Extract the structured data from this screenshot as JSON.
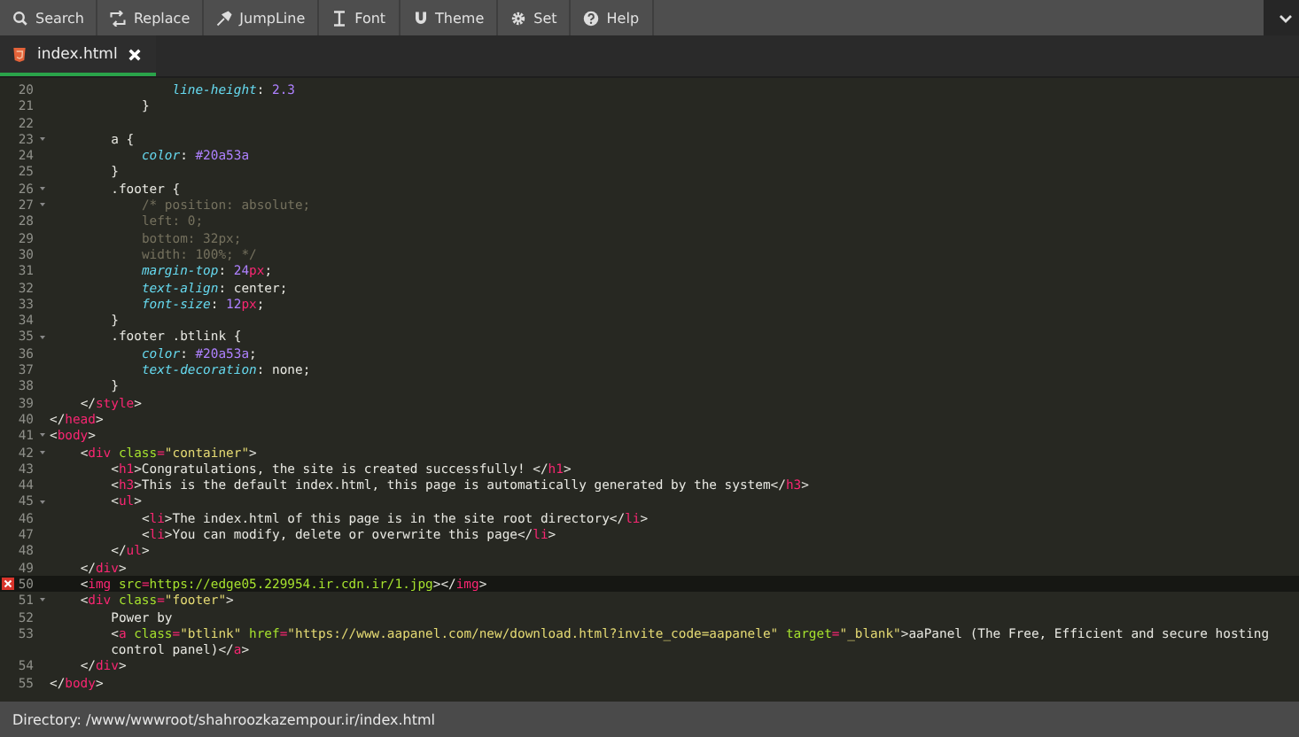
{
  "toolbar": [
    {
      "label": "Search"
    },
    {
      "label": "Replace"
    },
    {
      "label": "JumpLine"
    },
    {
      "label": "Font"
    },
    {
      "label": "Theme"
    },
    {
      "label": "Set"
    },
    {
      "label": "Help"
    }
  ],
  "tabs": [
    {
      "label": "index.html",
      "selected": true
    }
  ],
  "editor": {
    "lines": [
      {
        "number": "20",
        "foldable": false,
        "error": false,
        "current": false,
        "tokens": [
          {
            "kind": "prop",
            "text": "                line-height"
          },
          {
            "kind": "plain",
            "text": ": "
          },
          {
            "kind": "num",
            "text": "2.3"
          }
        ]
      },
      {
        "number": "21",
        "foldable": false,
        "error": false,
        "current": false,
        "tokens": [
          {
            "kind": "plain",
            "text": "            }"
          }
        ]
      },
      {
        "number": "22",
        "foldable": false,
        "error": false,
        "current": false
      },
      {
        "number": "23",
        "foldable": true,
        "error": false,
        "current": false,
        "tokens": [
          {
            "kind": "plain",
            "text": "        a {"
          }
        ]
      },
      {
        "number": "24",
        "foldable": false,
        "error": false,
        "current": false,
        "tokens": [
          {
            "kind": "prop",
            "text": "            color"
          },
          {
            "kind": "plain",
            "text": ": "
          },
          {
            "kind": "num",
            "text": "#20a53a"
          }
        ]
      },
      {
        "number": "25",
        "foldable": false,
        "error": false,
        "current": false,
        "tokens": [
          {
            "kind": "plain",
            "text": "        }"
          }
        ]
      },
      {
        "number": "26",
        "foldable": true,
        "error": false,
        "current": false,
        "tokens": [
          {
            "kind": "plain",
            "text": "        .footer {"
          }
        ]
      },
      {
        "number": "27",
        "foldable": true,
        "error": false,
        "current": false,
        "tokens": [
          {
            "kind": "comment",
            "text": "            /* position: absolute;"
          }
        ]
      },
      {
        "number": "28",
        "foldable": false,
        "error": false,
        "current": false,
        "tokens": [
          {
            "kind": "comment",
            "text": "            left: 0;"
          }
        ]
      },
      {
        "number": "29",
        "foldable": false,
        "error": false,
        "current": false,
        "tokens": [
          {
            "kind": "comment",
            "text": "            bottom: 32px;"
          }
        ]
      },
      {
        "number": "30",
        "foldable": false,
        "error": false,
        "current": false,
        "tokens": [
          {
            "kind": "comment",
            "text": "            width: 100%; */"
          }
        ]
      },
      {
        "number": "31",
        "foldable": false,
        "error": false,
        "current": false,
        "tokens": [
          {
            "kind": "prop",
            "text": "            margin-top"
          },
          {
            "kind": "plain",
            "text": ": "
          },
          {
            "kind": "num",
            "text": "24"
          },
          {
            "kind": "unit",
            "text": "px"
          },
          {
            "kind": "plain",
            "text": ";"
          }
        ]
      },
      {
        "number": "32",
        "foldable": false,
        "error": false,
        "current": false,
        "tokens": [
          {
            "kind": "prop",
            "text": "            text-align"
          },
          {
            "kind": "plain",
            "text": ": center;"
          }
        ]
      },
      {
        "number": "33",
        "foldable": false,
        "error": false,
        "current": false,
        "tokens": [
          {
            "kind": "prop",
            "text": "            font-size"
          },
          {
            "kind": "plain",
            "text": ": "
          },
          {
            "kind": "num",
            "text": "12"
          },
          {
            "kind": "unit",
            "text": "px"
          },
          {
            "kind": "plain",
            "text": ";"
          }
        ]
      },
      {
        "number": "34",
        "foldable": false,
        "error": false,
        "current": false,
        "tokens": [
          {
            "kind": "plain",
            "text": "        }"
          }
        ]
      },
      {
        "number": "35",
        "foldable": true,
        "error": false,
        "current": false,
        "tokens": [
          {
            "kind": "plain",
            "text": "        .footer .btlink {"
          }
        ]
      },
      {
        "number": "36",
        "foldable": false,
        "error": false,
        "current": false,
        "tokens": [
          {
            "kind": "prop",
            "text": "            color"
          },
          {
            "kind": "plain",
            "text": ": "
          },
          {
            "kind": "num",
            "text": "#20a53a"
          },
          {
            "kind": "plain",
            "text": ";"
          }
        ]
      },
      {
        "number": "37",
        "foldable": false,
        "error": false,
        "current": false,
        "tokens": [
          {
            "kind": "prop",
            "text": "            text-decoration"
          },
          {
            "kind": "plain",
            "text": ": none;"
          }
        ]
      },
      {
        "number": "38",
        "foldable": false,
        "error": false,
        "current": false,
        "tokens": [
          {
            "kind": "plain",
            "text": "        }"
          }
        ]
      },
      {
        "number": "39",
        "foldable": false,
        "error": false,
        "current": false,
        "tokens": [
          {
            "kind": "plain",
            "text": "    </"
          },
          {
            "kind": "tag",
            "text": "style"
          },
          {
            "kind": "plain",
            "text": ">"
          }
        ]
      },
      {
        "number": "40",
        "foldable": false,
        "error": false,
        "current": false,
        "tokens": [
          {
            "kind": "plain",
            "text": "</"
          },
          {
            "kind": "tag",
            "text": "head"
          },
          {
            "kind": "plain",
            "text": ">"
          }
        ]
      },
      {
        "number": "41",
        "foldable": true,
        "error": false,
        "current": false,
        "tokens": [
          {
            "kind": "plain",
            "text": "<"
          },
          {
            "kind": "tag",
            "text": "body"
          },
          {
            "kind": "plain",
            "text": ">"
          }
        ]
      },
      {
        "number": "42",
        "foldable": true,
        "error": false,
        "current": false,
        "tokens": [
          {
            "kind": "plain",
            "text": "    <"
          },
          {
            "kind": "tag",
            "text": "div"
          },
          {
            "kind": "attr",
            "text": " class"
          },
          {
            "kind": "tag",
            "text": "="
          },
          {
            "kind": "str",
            "text": "\"container\""
          },
          {
            "kind": "plain",
            "text": ">"
          }
        ]
      },
      {
        "number": "43",
        "foldable": false,
        "error": false,
        "current": false,
        "tokens": [
          {
            "kind": "plain",
            "text": "        <"
          },
          {
            "kind": "tag",
            "text": "h1"
          },
          {
            "kind": "plain",
            "text": ">Congratulations, the site is created successfully! </"
          },
          {
            "kind": "tag",
            "text": "h1"
          },
          {
            "kind": "plain",
            "text": ">"
          }
        ]
      },
      {
        "number": "44",
        "foldable": false,
        "error": false,
        "current": false,
        "tokens": [
          {
            "kind": "plain",
            "text": "        <"
          },
          {
            "kind": "tag",
            "text": "h3"
          },
          {
            "kind": "plain",
            "text": ">This is the default index.html, this page is automatically generated by the system</"
          },
          {
            "kind": "tag",
            "text": "h3"
          },
          {
            "kind": "plain",
            "text": ">"
          }
        ]
      },
      {
        "number": "45",
        "foldable": true,
        "error": false,
        "current": false,
        "tokens": [
          {
            "kind": "plain",
            "text": "        <"
          },
          {
            "kind": "tag",
            "text": "ul"
          },
          {
            "kind": "plain",
            "text": ">"
          }
        ]
      },
      {
        "number": "46",
        "foldable": false,
        "error": false,
        "current": false,
        "tokens": [
          {
            "kind": "plain",
            "text": "            <"
          },
          {
            "kind": "tag",
            "text": "li"
          },
          {
            "kind": "plain",
            "text": ">The index.html of this page is in the site root directory</"
          },
          {
            "kind": "tag",
            "text": "li"
          },
          {
            "kind": "plain",
            "text": ">"
          }
        ]
      },
      {
        "number": "47",
        "foldable": false,
        "error": false,
        "current": false,
        "tokens": [
          {
            "kind": "plain",
            "text": "            <"
          },
          {
            "kind": "tag",
            "text": "li"
          },
          {
            "kind": "plain",
            "text": ">You can modify, delete or overwrite this page</"
          },
          {
            "kind": "tag",
            "text": "li"
          },
          {
            "kind": "plain",
            "text": ">"
          }
        ]
      },
      {
        "number": "48",
        "foldable": false,
        "error": false,
        "current": false,
        "tokens": [
          {
            "kind": "plain",
            "text": "        </"
          },
          {
            "kind": "tag",
            "text": "ul"
          },
          {
            "kind": "plain",
            "text": ">"
          }
        ]
      },
      {
        "number": "49",
        "foldable": false,
        "error": false,
        "current": false,
        "tokens": [
          {
            "kind": "plain",
            "text": "    </"
          },
          {
            "kind": "tag",
            "text": "div"
          },
          {
            "kind": "plain",
            "text": ">"
          }
        ]
      },
      {
        "number": "50",
        "foldable": false,
        "error": true,
        "current": true,
        "tokens": [
          {
            "kind": "plain",
            "text": "    <"
          },
          {
            "kind": "tag",
            "text": "img"
          },
          {
            "kind": "attr",
            "text": " src"
          },
          {
            "kind": "tag",
            "text": "="
          },
          {
            "kind": "attr",
            "text": "https://edge05.229954.ir.cdn.ir/1.jpg"
          },
          {
            "kind": "plain",
            "text": "></"
          },
          {
            "kind": "tag",
            "text": "img"
          },
          {
            "kind": "plain",
            "text": ">"
          }
        ]
      },
      {
        "number": "51",
        "foldable": true,
        "error": false,
        "current": false,
        "tokens": [
          {
            "kind": "plain",
            "text": "    <"
          },
          {
            "kind": "tag",
            "text": "div"
          },
          {
            "kind": "attr",
            "text": " class"
          },
          {
            "kind": "tag",
            "text": "="
          },
          {
            "kind": "str",
            "text": "\"footer\""
          },
          {
            "kind": "plain",
            "text": ">"
          }
        ]
      },
      {
        "number": "52",
        "foldable": false,
        "error": false,
        "current": false,
        "tokens": [
          {
            "kind": "plain",
            "text": "        Power by"
          }
        ]
      },
      {
        "number": "53",
        "foldable": false,
        "error": false,
        "current": false,
        "tokens": [
          {
            "kind": "plain",
            "text": "        <"
          },
          {
            "kind": "tag",
            "text": "a"
          },
          {
            "kind": "attr",
            "text": " class"
          },
          {
            "kind": "tag",
            "text": "="
          },
          {
            "kind": "str",
            "text": "\"btlink\""
          },
          {
            "kind": "attr",
            "text": " href"
          },
          {
            "kind": "tag",
            "text": "="
          },
          {
            "kind": "str",
            "text": "\"https://www.aapanel.com/new/download.html?invite_code=aapanele\""
          },
          {
            "kind": "attr",
            "text": " target"
          },
          {
            "kind": "tag",
            "text": "="
          },
          {
            "kind": "str",
            "text": "\"_blank\""
          },
          {
            "kind": "plain",
            "text": ">aaPanel (The Free, Efficient and secure hosting control panel)</"
          },
          {
            "kind": "tag",
            "text": "a"
          },
          {
            "kind": "plain",
            "text": ">"
          }
        ]
      },
      {
        "number": "54",
        "foldable": false,
        "error": false,
        "current": false,
        "tokens": [
          {
            "kind": "plain",
            "text": "    </"
          },
          {
            "kind": "tag",
            "text": "div"
          },
          {
            "kind": "plain",
            "text": ">"
          }
        ]
      },
      {
        "number": "55",
        "foldable": false,
        "error": false,
        "current": false,
        "tokens": [
          {
            "kind": "plain",
            "text": "</"
          },
          {
            "kind": "tag",
            "text": "body"
          },
          {
            "kind": "plain",
            "text": ">"
          }
        ]
      }
    ]
  },
  "status_bar": {
    "text": "Directory: /www/wwwroot/shahroozkazempour.ir/index.html"
  }
}
